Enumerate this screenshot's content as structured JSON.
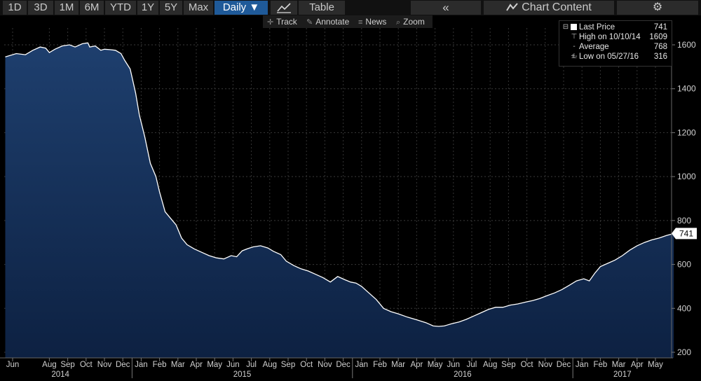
{
  "toolbar": {
    "range_buttons": [
      "1D",
      "3D",
      "1M",
      "6M",
      "YTD",
      "1Y",
      "5Y",
      "Max"
    ],
    "frequency": "Daily ▼",
    "table_label": "Table",
    "collapse_glyph": "«",
    "chart_content_label": "Chart Content",
    "settings_glyph": "⚙"
  },
  "subtoolbar": {
    "track": "Track",
    "annotate": "Annotate",
    "news": "News",
    "zoom": "Zoom"
  },
  "legend": {
    "last_price_label": "Last Price",
    "last_price_value": "741",
    "high_label": "High on 10/10/14",
    "high_value": "1609",
    "average_label": "Average",
    "average_value": "768",
    "low_label": "Low on 05/27/16",
    "low_value": "316"
  },
  "chart_data": {
    "type": "area",
    "y_ticks": [
      200,
      400,
      600,
      800,
      1000,
      1200,
      1400,
      1600
    ],
    "ylim": [
      180,
      1700
    ],
    "last_price_tag": "741",
    "month_labels": [
      {
        "label": "Jun",
        "pos": 0
      },
      {
        "label": "Aug",
        "pos": 2
      },
      {
        "label": "Sep",
        "pos": 3
      },
      {
        "label": "Oct",
        "pos": 4
      },
      {
        "label": "Nov",
        "pos": 5
      },
      {
        "label": "Dec",
        "pos": 6
      },
      {
        "label": "Jan",
        "pos": 7
      },
      {
        "label": "Feb",
        "pos": 8
      },
      {
        "label": "Mar",
        "pos": 9
      },
      {
        "label": "Apr",
        "pos": 10
      },
      {
        "label": "May",
        "pos": 11
      },
      {
        "label": "Jun",
        "pos": 12
      },
      {
        "label": "Jul",
        "pos": 13
      },
      {
        "label": "Aug",
        "pos": 14
      },
      {
        "label": "Sep",
        "pos": 15
      },
      {
        "label": "Oct",
        "pos": 16
      },
      {
        "label": "Nov",
        "pos": 17
      },
      {
        "label": "Dec",
        "pos": 18
      },
      {
        "label": "Jan",
        "pos": 19
      },
      {
        "label": "Feb",
        "pos": 20
      },
      {
        "label": "Mar",
        "pos": 21
      },
      {
        "label": "Apr",
        "pos": 22
      },
      {
        "label": "May",
        "pos": 23
      },
      {
        "label": "Jun",
        "pos": 24
      },
      {
        "label": "Jul",
        "pos": 25
      },
      {
        "label": "Aug",
        "pos": 26
      },
      {
        "label": "Sep",
        "pos": 27
      },
      {
        "label": "Oct",
        "pos": 28
      },
      {
        "label": "Nov",
        "pos": 29
      },
      {
        "label": "Dec",
        "pos": 30
      },
      {
        "label": "Jan",
        "pos": 31
      },
      {
        "label": "Feb",
        "pos": 32
      },
      {
        "label": "Mar",
        "pos": 33
      },
      {
        "label": "Apr",
        "pos": 34
      },
      {
        "label": "May",
        "pos": 35
      }
    ],
    "year_labels": [
      {
        "label": "2014",
        "pos": 2.6
      },
      {
        "label": "2015",
        "pos": 12.5
      },
      {
        "label": "2016",
        "pos": 24.5
      },
      {
        "label": "2017",
        "pos": 33.2
      }
    ],
    "year_dividers": [
      7,
      19,
      31
    ],
    "x": [
      -0.4,
      0.2,
      0.7,
      1.1,
      1.5,
      1.8,
      2.0,
      2.3,
      2.7,
      3.1,
      3.4,
      3.8,
      4.1,
      4.2,
      4.5,
      4.8,
      5.0,
      5.3,
      5.6,
      5.9,
      6.1,
      6.4,
      6.7,
      6.9,
      7.2,
      7.5,
      7.8,
      8.0,
      8.3,
      8.6,
      8.9,
      9.2,
      9.5,
      9.9,
      10.3,
      10.7,
      11.1,
      11.5,
      11.9,
      12.2,
      12.5,
      12.8,
      13.1,
      13.5,
      13.9,
      14.2,
      14.6,
      14.9,
      15.3,
      15.7,
      16.1,
      16.5,
      16.9,
      17.3,
      17.7,
      18.1,
      18.4,
      18.7,
      19.0,
      19.4,
      19.8,
      20.2,
      20.6,
      21.0,
      21.5,
      22.0,
      22.5,
      22.9,
      23.2,
      23.5,
      23.9,
      24.3,
      24.7,
      25.1,
      25.5,
      25.9,
      26.3,
      26.7,
      27.1,
      27.5,
      27.9,
      28.3,
      28.7,
      29.1,
      29.5,
      29.9,
      30.3,
      30.7,
      31.1,
      31.4,
      31.7,
      32.0,
      32.4,
      32.8,
      33.2,
      33.6,
      34.0,
      34.4,
      34.8,
      35.2,
      35.6,
      36.0
    ],
    "y": [
      1545,
      1560,
      1555,
      1575,
      1590,
      1585,
      1565,
      1580,
      1595,
      1600,
      1590,
      1605,
      1609,
      1590,
      1595,
      1575,
      1580,
      1578,
      1575,
      1560,
      1530,
      1490,
      1380,
      1280,
      1180,
      1060,
      1000,
      930,
      840,
      810,
      780,
      720,
      690,
      670,
      655,
      640,
      630,
      625,
      640,
      635,
      662,
      672,
      680,
      685,
      675,
      660,
      645,
      615,
      595,
      580,
      570,
      555,
      540,
      520,
      545,
      530,
      520,
      515,
      500,
      470,
      440,
      400,
      385,
      375,
      360,
      348,
      335,
      320,
      318,
      320,
      330,
      338,
      350,
      365,
      380,
      395,
      405,
      405,
      415,
      420,
      428,
      435,
      445,
      458,
      470,
      485,
      505,
      525,
      535,
      525,
      560,
      590,
      605,
      620,
      640,
      665,
      685,
      700,
      712,
      720,
      732,
      741
    ]
  }
}
